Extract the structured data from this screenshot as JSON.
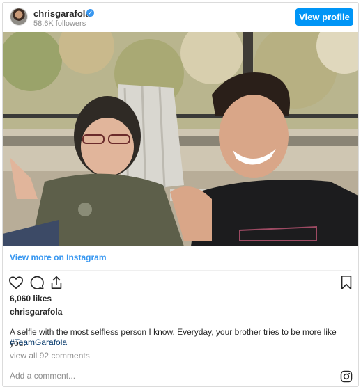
{
  "header": {
    "username": "chrisgarafola",
    "followers": "58.6K followers",
    "view_profile_label": "View profile"
  },
  "embed": {
    "view_more_label": "View more on Instagram"
  },
  "post": {
    "likes": "6,060 likes",
    "author": "chrisgarafola",
    "caption": "A selfie with the most selfless person I know. Everyday, your brother tries to be more like you.",
    "hashtag": "#TeamGarafola",
    "comments_link": "view all 92 comments"
  },
  "comment_box": {
    "placeholder": "Add a comment..."
  },
  "icons": {
    "like": "heart-icon",
    "comment": "comment-icon",
    "share": "share-icon",
    "save": "bookmark-icon",
    "brand": "instagram-icon",
    "verified": "verified-badge-icon"
  },
  "colors": {
    "accent": "#0095f6",
    "link": "#3897f0",
    "hashtag": "#003569",
    "muted": "#8e8e8e",
    "text": "#262626"
  }
}
